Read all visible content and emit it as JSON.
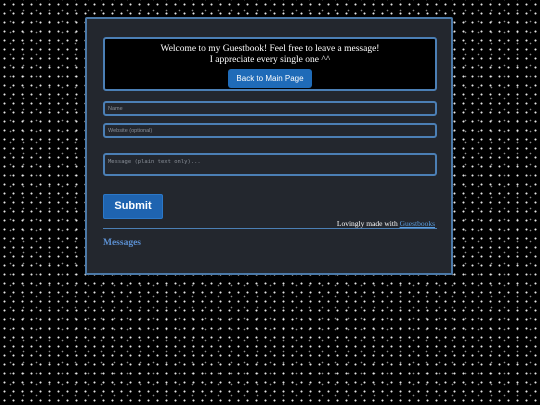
{
  "header": {
    "welcome_line1": "Welcome to my Guestbook! Feel free to leave a message!",
    "welcome_line2": "I appreciate every single one ^^",
    "back_button": "Back to Main Page"
  },
  "form": {
    "name_placeholder": "Name",
    "website_placeholder": "Website (optional)",
    "message_placeholder": "Message (plain text only)...",
    "submit_label": "Submit"
  },
  "footer": {
    "credit_text": "Lovingly made with ",
    "credit_link": "Guestbooks"
  },
  "messages": {
    "heading": "Messages"
  },
  "colors": {
    "background": "#000000",
    "panel": "#23272e",
    "accent": "#4b7fb5",
    "button": "#1f64b0",
    "heading": "#5b8fd1"
  }
}
